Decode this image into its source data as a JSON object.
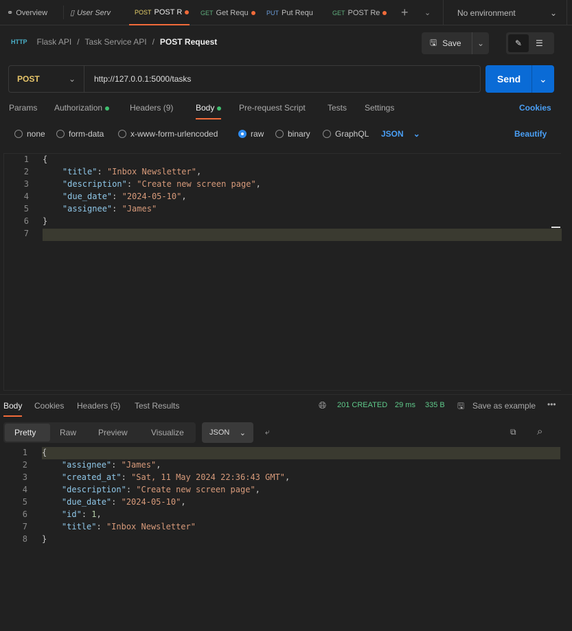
{
  "tabs": [
    {
      "label": "Overview",
      "icon": "overview-icon"
    },
    {
      "label": "User Serv",
      "icon": "collection-icon"
    },
    {
      "method": "POST",
      "label": "POST R",
      "unsaved": true,
      "active": true
    },
    {
      "method": "GET",
      "label": "Get Requ",
      "unsaved": true
    },
    {
      "method": "PUT",
      "label": "Put Requ",
      "unsaved": false
    },
    {
      "method": "GET",
      "label": "POST Re",
      "unsaved": true
    }
  ],
  "environment": "No environment",
  "breadcrumb": {
    "items": [
      "Flask API",
      "Task Service API"
    ],
    "current": "POST Request"
  },
  "toolbar": {
    "save": "Save"
  },
  "request": {
    "method": "POST",
    "url": "http://127.0.0.1:5000/tasks",
    "send": "Send"
  },
  "request_tabs": {
    "params": "Params",
    "authorization": "Authorization",
    "headers": "Headers (9)",
    "body": "Body",
    "prescript": "Pre-request Script",
    "tests": "Tests",
    "settings": "Settings",
    "cookies": "Cookies"
  },
  "body_types": {
    "none": "none",
    "form_data": "form-data",
    "urlencoded": "x-www-form-urlencoded",
    "raw": "raw",
    "binary": "binary",
    "graphql": "GraphQL",
    "format": "JSON",
    "beautify": "Beautify",
    "selected": "raw"
  },
  "request_body": [
    "{",
    "    \"title\": \"Inbox Newsletter\",",
    "    \"description\": \"Create new screen page\",",
    "    \"due_date\": \"2024-05-10\",",
    "    \"assignee\": \"James\"",
    "}",
    ""
  ],
  "response_tabs": {
    "body": "Body",
    "cookies": "Cookies",
    "headers": "Headers (5)",
    "tests": "Test Results"
  },
  "response_status": {
    "status": "201 CREATED",
    "time": "29 ms",
    "size": "335 B",
    "save_example": "Save as example",
    "color": "#5fc98a"
  },
  "view_modes": {
    "pretty": "Pretty",
    "raw": "Raw",
    "preview": "Preview",
    "visualize": "Visualize",
    "format": "JSON"
  },
  "response_body": [
    "{",
    "    \"assignee\": \"James\",",
    "    \"created_at\": \"Sat, 11 May 2024 22:36:43 GMT\",",
    "    \"description\": \"Create new screen page\",",
    "    \"due_date\": \"2024-05-10\",",
    "    \"id\": 1,",
    "    \"title\": \"Inbox Newsletter\"",
    "}"
  ],
  "colors": {
    "accent": "#f26b3a",
    "send": "#0a6bd6",
    "link": "#4a9ff5"
  }
}
